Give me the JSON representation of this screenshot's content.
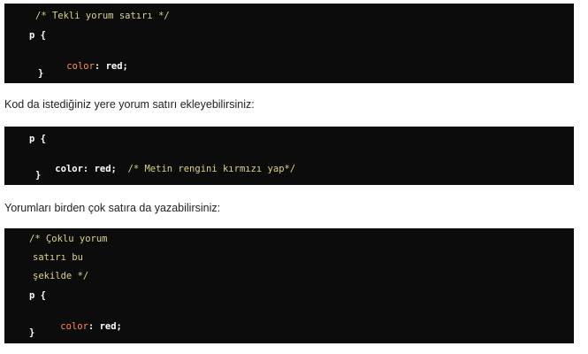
{
  "block1": {
    "comment": "/* Tekli yorum satırı */",
    "selector": "p {",
    "property": "color",
    "colon": ":",
    "value": "red;",
    "close": "}"
  },
  "prose1": "Kod da istediğiniz yere yorum satırı ekleyebilirsiniz:",
  "block2": {
    "selector": "p {",
    "property": "color",
    "colon": ":",
    "value": "red;",
    "comment": "/* Metin rengini kırmızı yap*/",
    "close": "}"
  },
  "prose2": "Yorumları birden çok satıra da yazabilirsiniz:",
  "block3": {
    "comment_line1": "/* Çoklu yorum",
    "comment_line2": "satırı bu",
    "comment_line3": "şekilde */",
    "selector": "p {",
    "property": "color",
    "colon": ":",
    "value": "red;",
    "close": "}"
  }
}
